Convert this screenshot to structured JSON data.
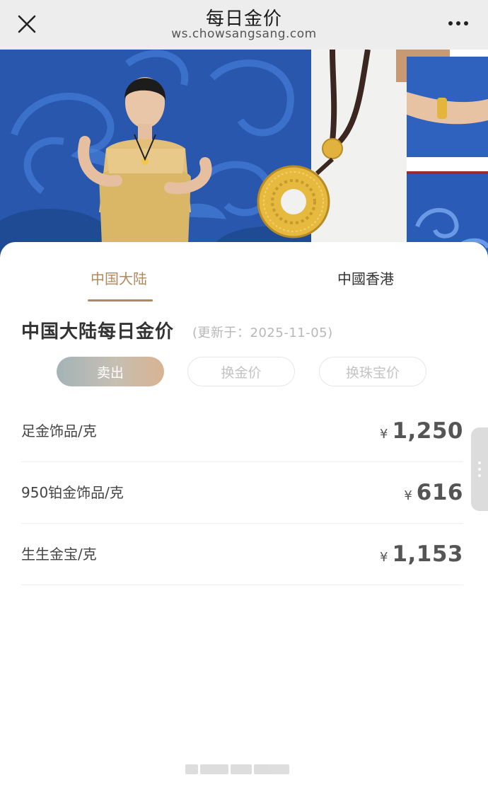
{
  "header": {
    "title": "每日金价",
    "url": "ws.chowsangsang.com"
  },
  "icons": {
    "close": "close-icon",
    "more": "more-dots-icon",
    "handle": "side-handle-icon"
  },
  "colors": {
    "accent": "#b08a5e",
    "banner_blue": "#2f5fb5",
    "gold": "#e3b53c"
  },
  "tabs": [
    {
      "label": "中国大陆",
      "active": true
    },
    {
      "label": "中國香港",
      "active": false
    }
  ],
  "section": {
    "title": "中国大陆每日金价",
    "updated": "(更新于：2025-11-05)"
  },
  "filters": [
    {
      "label": "卖出",
      "active": true
    },
    {
      "label": "换金价",
      "active": false
    },
    {
      "label": "换珠宝价",
      "active": false
    }
  ],
  "prices": [
    {
      "name": "足金饰品/克",
      "currency": "¥",
      "value": "1,250"
    },
    {
      "name": "950铂金饰品/克",
      "currency": "¥",
      "value": "616"
    },
    {
      "name": "生生金宝/克",
      "currency": "¥",
      "value": "1,153"
    }
  ]
}
